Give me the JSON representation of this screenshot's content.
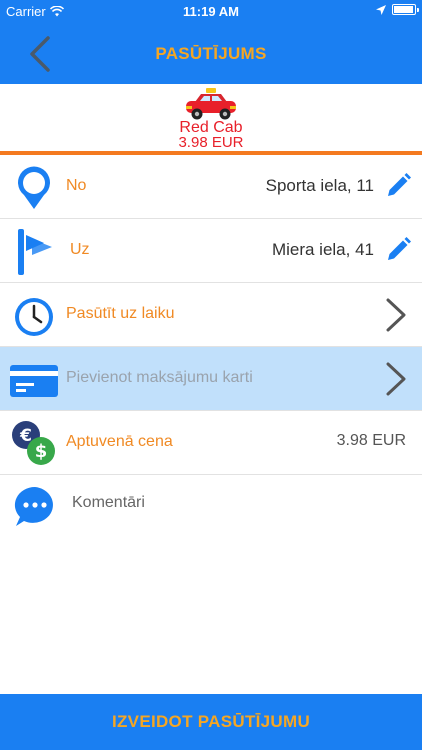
{
  "status_bar": {
    "carrier": "Carrier",
    "time": "11:19 AM"
  },
  "nav": {
    "title": "PASŪTĪJUMS"
  },
  "cab": {
    "name": "Red Cab",
    "price": "3.98 EUR"
  },
  "rows": {
    "from": {
      "label": "No",
      "value": "Sporta iela, 11"
    },
    "to": {
      "label": "Uz",
      "value": "Miera iela, 41"
    },
    "schedule": {
      "label": "Pasūtīt uz laiku"
    },
    "payment": {
      "placeholder": "Pievienot maksājumu karti"
    },
    "estimate": {
      "label": "Aptuvenā cena",
      "value": "3.98 EUR"
    },
    "comment": {
      "label": "Komentāri"
    }
  },
  "submit_label": "IZVEIDOT PASŪTĪJUMU",
  "colors": {
    "primary": "#1a7ff2",
    "accent": "#f5a623",
    "label": "#f08a24",
    "cab_red": "#e8202a",
    "highlight": "#c1e0fb"
  },
  "icons": [
    "wifi-icon",
    "location-arrow-icon",
    "battery-icon",
    "back-arrow-icon",
    "car-icon",
    "map-pin-icon",
    "destination-flag-icon",
    "pencil-icon",
    "clock-icon",
    "chevron-right-icon",
    "credit-card-icon",
    "currency-coins-icon",
    "chat-bubble-icon"
  ]
}
